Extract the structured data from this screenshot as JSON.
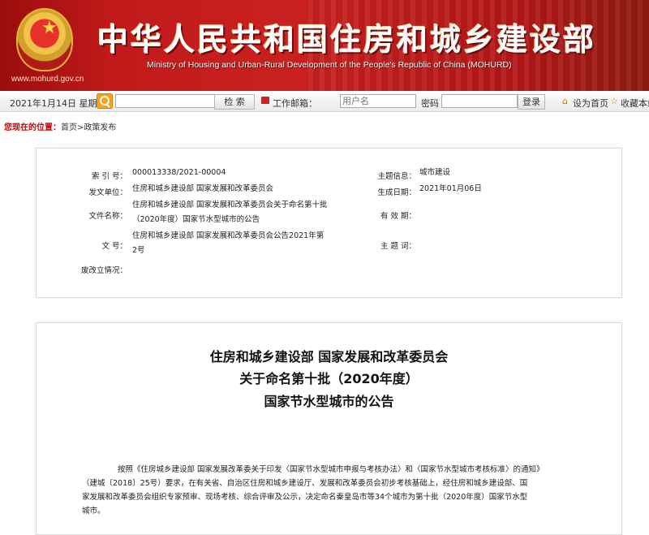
{
  "header": {
    "title": "中华人民共和国住房和城乡建设部",
    "subtitle": "Ministry of Housing and Urban-Rural Development of the People's Republic of China (MOHURD)",
    "url": "www.mohurd.gov.cn"
  },
  "toolbar": {
    "date": "2021年1月14日  星期四",
    "search_button": "检  索",
    "mail_label": "工作邮箱：",
    "username_placeholder": "用户名",
    "password_label": "密码",
    "login_button": "登录",
    "set_home": "设为首页",
    "favorite": "收藏本站"
  },
  "breadcrumb": {
    "label": "您现在的位置：",
    "path": "首页>政策发布"
  },
  "info": {
    "index_label": "索 引 号：",
    "index_value": "000013338/2021-00004",
    "issuer_label": "发文单位：",
    "issuer_value": "住房和城乡建设部   国家发展和改革委员会",
    "filename_label": "文件名称：",
    "filename_value_line1": "住房和城乡建设部 国家发展和改革委员会关于命名第十批",
    "filename_value_line2": "（2020年度）国家节水型城市的公告",
    "docno_label": "文      号：",
    "docno_value_line1": "住房和城乡建设部   国家发展和改革委员会公告2021年第",
    "docno_value_line2": "2号",
    "amend_label": "废改立情况：",
    "topic_label": "主题信息：",
    "topic_value": "城市建设",
    "date_label": "生成日期：",
    "date_value": "2021年01月06日",
    "valid_label": "有 效 期：",
    "keywords_label": "主 题 词："
  },
  "article": {
    "title_line1": "住房和城乡建设部 国家发展和改革委员会",
    "title_line2": "关于命名第十批（2020年度）",
    "title_line3": "国家节水型城市的公告",
    "para_line1": "按照《住房城乡建设部 国家发展改革委关于印发〈国家节水型城市申报与考核办法〉和〈国家节水型城市考核标准〉的通知》",
    "para_line2": "（建城〔2018〕25号）要求，在有关省、自治区住房和城乡建设厅、发展和改革委员会初步考核基础上，经住房和城乡建设部、国",
    "para_line3": "家发展和改革委员会组织专家预审、现场考核、综合评审及公示，决定命名秦皇岛市等34个城市为第十批（2020年度）国家节水型",
    "para_line4": "城市。"
  }
}
